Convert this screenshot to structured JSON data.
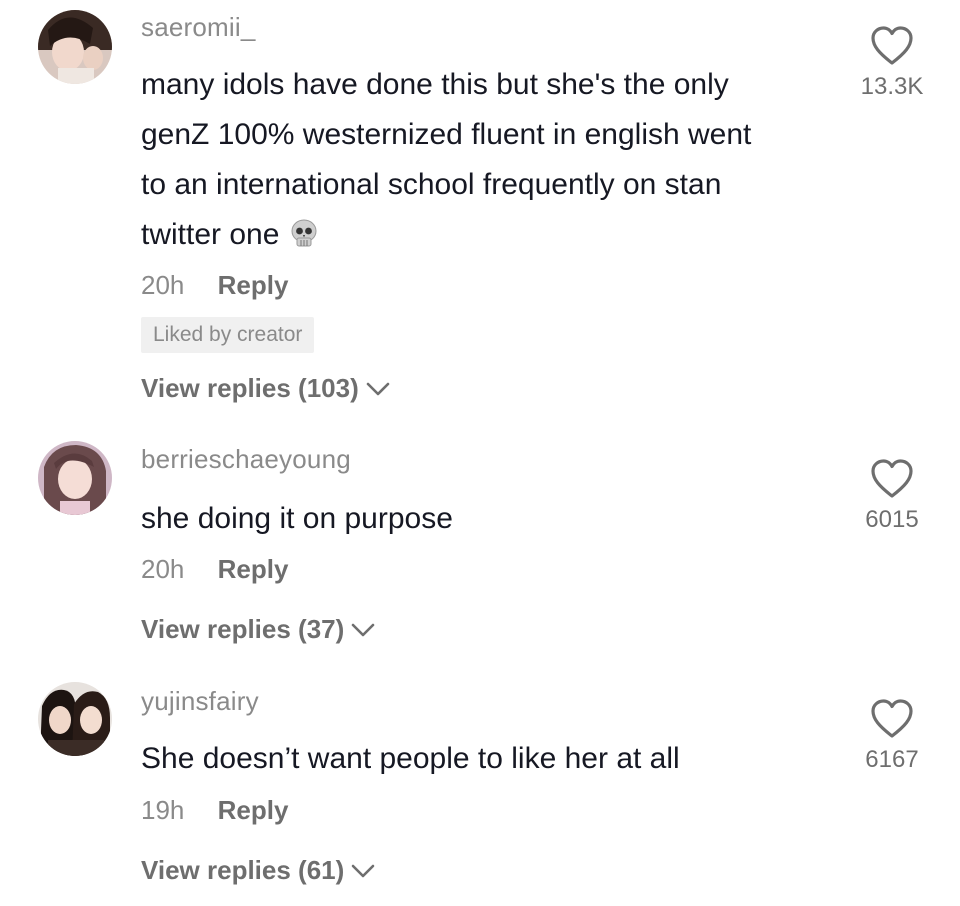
{
  "comments": [
    {
      "username": "saeromii_",
      "text_lines": [
        "many idols have done this but she's the only",
        "genZ 100% westernized fluent in english went",
        "to an international school frequently on stan",
        "twitter one"
      ],
      "emoji": "skull",
      "time": "20h",
      "reply_label": "Reply",
      "badge": "Liked by creator",
      "view_replies": "View replies (103)",
      "likes": "13.3K"
    },
    {
      "username": "berrieschaeyoung",
      "text_lines": [
        "she doing it on purpose"
      ],
      "time": "20h",
      "reply_label": "Reply",
      "view_replies": "View replies (37)",
      "likes": "6015"
    },
    {
      "username": "yujinsfairy",
      "text_lines": [
        "She doesn’t want people to like her at all"
      ],
      "time": "19h",
      "reply_label": "Reply",
      "view_replies": "View replies (61)",
      "likes": "6167"
    }
  ],
  "icons": {
    "like": "heart-outline-icon",
    "expand": "chevron-down-icon",
    "emoji": "skull-icon"
  },
  "colors": {
    "username": "#8a8a8a",
    "text": "#161823",
    "secondary": "#6e6e6e",
    "badge_bg": "#f0f0f0"
  }
}
